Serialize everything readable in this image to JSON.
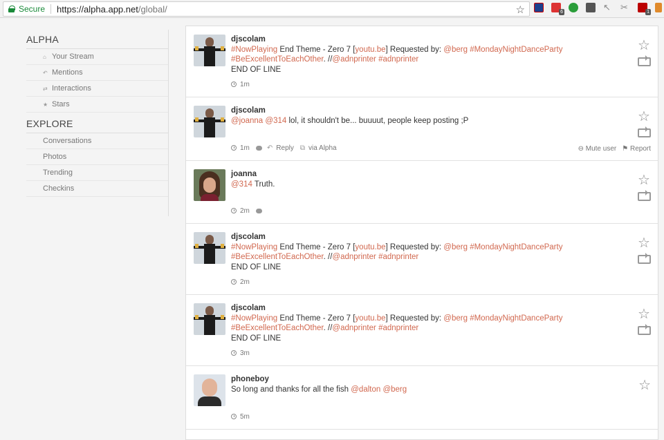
{
  "browser": {
    "secure_label": "Secure",
    "url_host": "https://alpha.app.net",
    "url_path": "/global/",
    "ext_badges": [
      "6",
      "1"
    ]
  },
  "sidebar": {
    "alpha_heading": "ALPHA",
    "alpha_items": [
      {
        "label": "Your Stream",
        "icon": "home-icon",
        "glyph": "⌂"
      },
      {
        "label": "Mentions",
        "icon": "reply-icon",
        "glyph": "↶"
      },
      {
        "label": "Interactions",
        "icon": "arrows-icon",
        "glyph": "⇄"
      },
      {
        "label": "Stars",
        "icon": "star-icon",
        "glyph": "★"
      }
    ],
    "explore_heading": "EXPLORE",
    "explore_items": [
      {
        "label": "Conversations"
      },
      {
        "label": "Photos"
      },
      {
        "label": "Trending"
      },
      {
        "label": "Checkins"
      }
    ]
  },
  "posts": [
    {
      "user": "djscolam",
      "lines": [
        [
          {
            "t": "#NowPlaying",
            "l": true
          },
          {
            "t": " End Theme - Zero 7 ["
          },
          {
            "t": "youtu.be",
            "l": true
          },
          {
            "t": "] Requested by: "
          },
          {
            "t": "@berg",
            "l": true
          },
          {
            "t": " "
          },
          {
            "t": "#MondayNightDanceParty",
            "l": true
          }
        ],
        [
          {
            "t": "#BeExcellentToEachOther",
            "l": true
          },
          {
            "t": ". //"
          },
          {
            "t": "@adnprinter",
            "l": true
          },
          {
            "t": " "
          },
          {
            "t": "#adnprinter",
            "l": true
          }
        ],
        [
          {
            "t": "END OF LINE"
          }
        ]
      ],
      "time": "1m",
      "extra": false
    },
    {
      "user": "djscolam",
      "lines": [
        [
          {
            "t": "@joanna",
            "l": true
          },
          {
            "t": " "
          },
          {
            "t": "@314",
            "l": true
          },
          {
            "t": " lol, it shouldn't be... buuuut, people keep posting ;P"
          }
        ]
      ],
      "time": "1m",
      "extra": true,
      "reply": "Reply",
      "via": "via Alpha",
      "mute": "Mute user",
      "report": "Report"
    },
    {
      "user": "joanna",
      "lines": [
        [
          {
            "t": "@314",
            "l": true
          },
          {
            "t": " Truth."
          }
        ]
      ],
      "time": "2m",
      "extra": false,
      "bubble": true
    },
    {
      "user": "djscolam",
      "lines": [
        [
          {
            "t": "#NowPlaying",
            "l": true
          },
          {
            "t": " End Theme - Zero 7 ["
          },
          {
            "t": "youtu.be",
            "l": true
          },
          {
            "t": "] Requested by: "
          },
          {
            "t": "@berg",
            "l": true
          },
          {
            "t": " "
          },
          {
            "t": "#MondayNightDanceParty",
            "l": true
          }
        ],
        [
          {
            "t": "#BeExcellentToEachOther",
            "l": true
          },
          {
            "t": ". //"
          },
          {
            "t": "@adnprinter",
            "l": true
          },
          {
            "t": " "
          },
          {
            "t": "#adnprinter",
            "l": true
          }
        ],
        [
          {
            "t": "END OF LINE"
          }
        ]
      ],
      "time": "2m",
      "extra": false
    },
    {
      "user": "djscolam",
      "lines": [
        [
          {
            "t": "#NowPlaying",
            "l": true
          },
          {
            "t": " End Theme - Zero 7 ["
          },
          {
            "t": "youtu.be",
            "l": true
          },
          {
            "t": "] Requested by: "
          },
          {
            "t": "@berg",
            "l": true
          },
          {
            "t": " "
          },
          {
            "t": "#MondayNightDanceParty",
            "l": true
          }
        ],
        [
          {
            "t": "#BeExcellentToEachOther",
            "l": true
          },
          {
            "t": ". //"
          },
          {
            "t": "@adnprinter",
            "l": true
          },
          {
            "t": " "
          },
          {
            "t": "#adnprinter",
            "l": true
          }
        ],
        [
          {
            "t": "END OF LINE"
          }
        ]
      ],
      "time": "3m",
      "extra": false
    },
    {
      "user": "phoneboy",
      "lines": [
        [
          {
            "t": "So long and thanks for all the fish "
          },
          {
            "t": "@dalton",
            "l": true
          },
          {
            "t": " "
          },
          {
            "t": "@berg",
            "l": true
          }
        ]
      ],
      "time": "5m",
      "extra": false,
      "norepost": true
    }
  ],
  "colors": {
    "link": "#d1684f",
    "secure": "#1a8a3a"
  }
}
